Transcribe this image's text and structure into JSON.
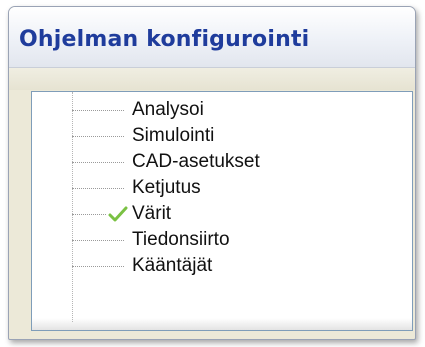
{
  "window": {
    "title": "Ohjelman konfigurointi"
  },
  "tree": {
    "items": [
      {
        "label": "Analysoi",
        "checked": false
      },
      {
        "label": "Simulointi",
        "checked": false
      },
      {
        "label": "CAD-asetukset",
        "checked": false
      },
      {
        "label": "Ketjutus",
        "checked": false
      },
      {
        "label": "Värit",
        "checked": true
      },
      {
        "label": "Tiedonsiirto",
        "checked": false
      },
      {
        "label": "Kääntäjät",
        "checked": false
      }
    ]
  },
  "colors": {
    "title_text": "#1f3c9c",
    "check_mark": "#7ac143",
    "panel_border": "#7f9db9"
  }
}
